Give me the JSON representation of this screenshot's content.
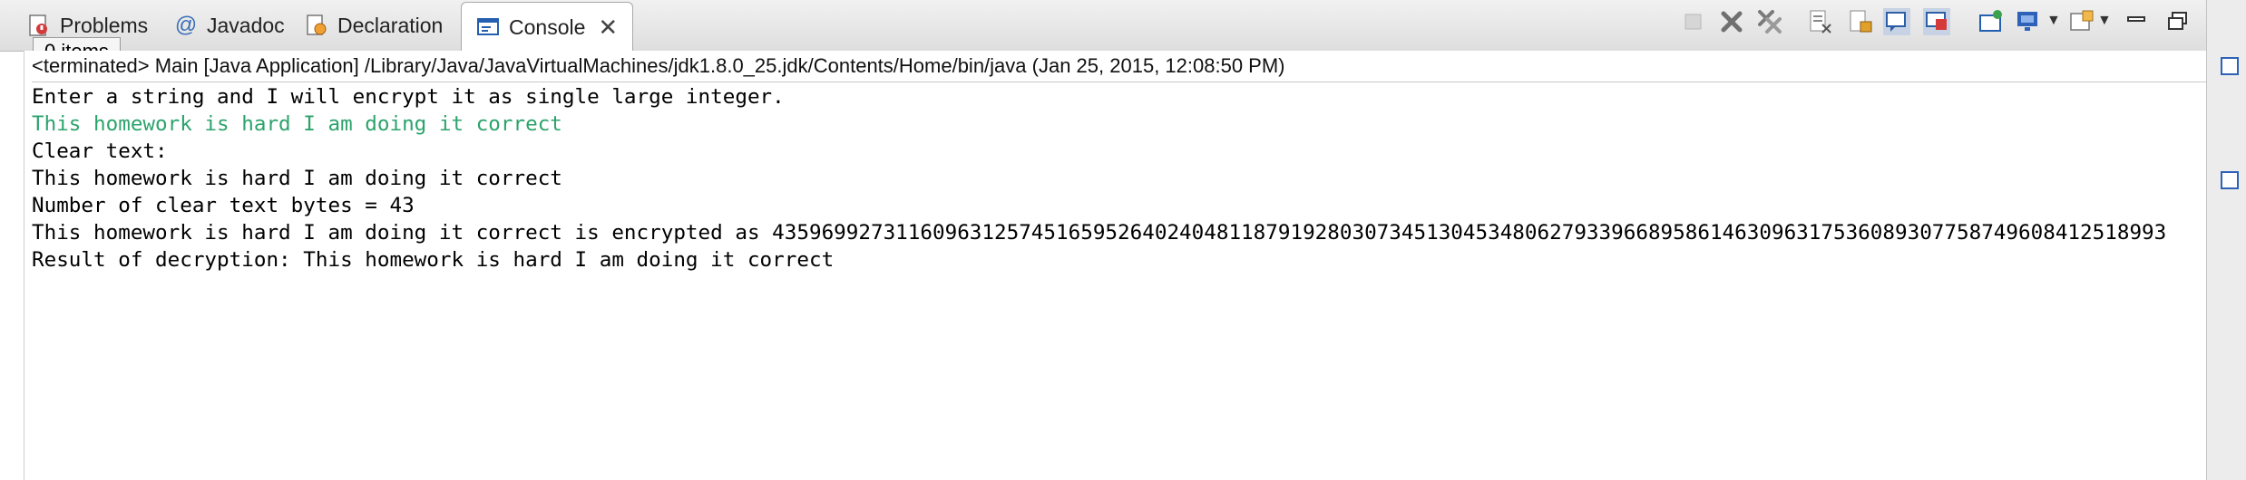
{
  "tabs": [
    {
      "label": "Problems",
      "icon": "problems-icon"
    },
    {
      "label": "Javadoc",
      "icon": "at-icon"
    },
    {
      "label": "Declaration",
      "icon": "declaration-icon"
    },
    {
      "label": "Console",
      "icon": "console-icon",
      "active": true
    }
  ],
  "tooltip": "0 items",
  "toolbar_icons": [
    "terminate-icon",
    "remove-launch-icon",
    "remove-all-terminated-icon",
    "clear-console-icon",
    "scroll-lock-icon",
    "show-on-stdout-icon",
    "show-on-stderr-icon",
    "pin-console-icon",
    "display-console-icon",
    "open-console-icon",
    "minimize-icon",
    "maximize-icon"
  ],
  "process_label": "<terminated> Main [Java Application] /Library/Java/JavaVirtualMachines/jdk1.8.0_25.jdk/Contents/Home/bin/java (Jan 25, 2015, 12:08:50 PM)",
  "console_lines": [
    "Enter a string and I will encrypt it as single large integer.",
    "This homework is hard I am doing it correct",
    "Clear text:",
    "This homework is hard I am doing it correct",
    "Number of clear text bytes = 43",
    "This homework is hard I am doing it correct is encrypted as 43596992731160963125745165952640240481187919280307345130453480627933966895861463096317536089307758749608412518993",
    "Result of decryption: This homework is hard I am doing it correct"
  ],
  "colors": {
    "user_input": "#2ca36c",
    "accent": "#1a5fb4"
  }
}
